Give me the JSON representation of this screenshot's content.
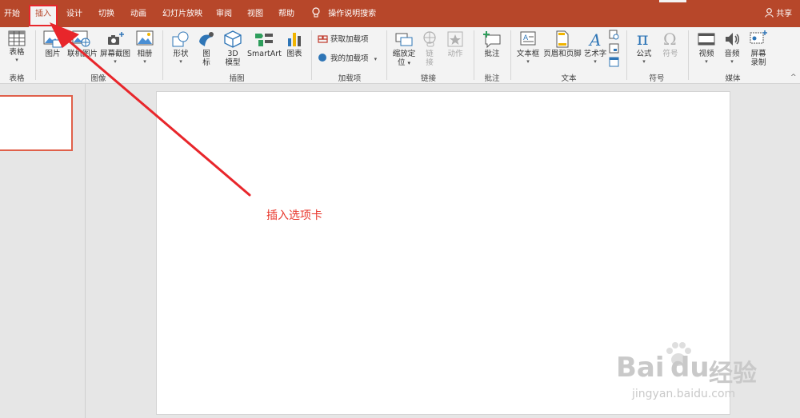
{
  "tabs": [
    {
      "label": "开始"
    },
    {
      "label": "插入"
    },
    {
      "label": "设计"
    },
    {
      "label": "切换"
    },
    {
      "label": "动画"
    },
    {
      "label": "幻灯片放映"
    },
    {
      "label": "审阅"
    },
    {
      "label": "视图"
    },
    {
      "label": "帮助"
    }
  ],
  "tell_me": "操作说明搜索",
  "share": "共享",
  "ribbon": {
    "groups": {
      "table": "表格",
      "images": "图像",
      "illustrations": "插图",
      "addins": "加载项",
      "links": "链接",
      "comments": "批注",
      "text": "文本",
      "symbols": "符号",
      "media": "媒体"
    },
    "commands": {
      "table": "表格",
      "picture": "图片",
      "online_picture": "联机图片",
      "screenshot": "屏幕截图",
      "album": "相册",
      "shapes": "形状",
      "icons_1": "图",
      "icons_2": "标",
      "model3d_1": "3D",
      "model3d_2": "模型",
      "smartart": "SmartArt",
      "chart": "图表",
      "get_addins": "获取加载项",
      "my_addins": "我的加载项",
      "zoom_1": "缩放定",
      "zoom_2": "位",
      "link_1": "链",
      "link_2": "接",
      "action": "动作",
      "comment": "批注",
      "textbox": "文本框",
      "header_footer": "页眉和页脚",
      "wordart": "艺术字",
      "equation": "公式",
      "symbol": "符号",
      "video": "视频",
      "audio": "音频",
      "screen_rec_1": "屏幕",
      "screen_rec_2": "录制"
    }
  },
  "annotation": "插入选项卡",
  "watermark": {
    "brand": "Bai",
    "brand2": "du",
    "cn": "经验",
    "url": "jingyan.baidu.com"
  },
  "colors": {
    "accent": "#b7472a",
    "annotation": "#e8362b"
  }
}
